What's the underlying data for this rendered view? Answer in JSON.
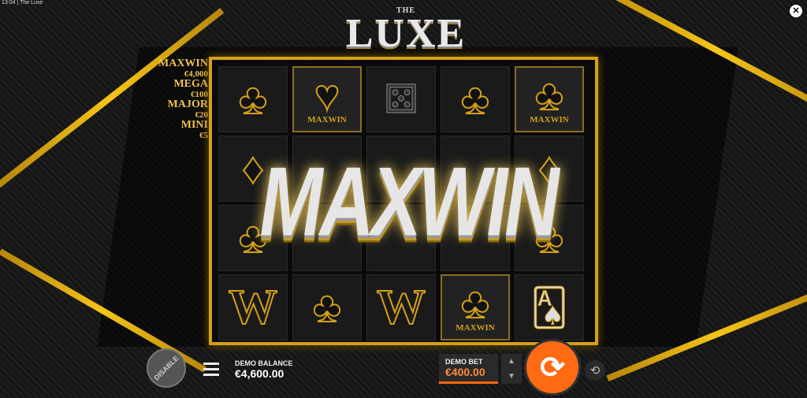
{
  "status": {
    "time": "13:04",
    "title": "The Luxe"
  },
  "logo": {
    "the": "THE",
    "name": "LUXE"
  },
  "jackpots": [
    {
      "name": "MAXWIN",
      "value": "€4,000"
    },
    {
      "name": "MEGA",
      "value": "€100"
    },
    {
      "name": "MAJOR",
      "value": "€20"
    },
    {
      "name": "MINI",
      "value": "€5"
    }
  ],
  "reels": {
    "maxwin_label": "MAXWIN",
    "banner": "MAXWIN"
  },
  "controls": {
    "disable_label": "DISABLE",
    "balance_label": "DEMO BALANCE",
    "balance_value": "€4,600.00",
    "bet_label": "DEMO BET",
    "bet_value": "€400.00"
  },
  "icons": {
    "close": "close-icon",
    "menu": "hamburger-menu-icon",
    "spin": "spin-icon",
    "autoplay": "autoplay-icon"
  },
  "colors": {
    "gold": "#d4a017",
    "accent": "#ff6a13"
  }
}
